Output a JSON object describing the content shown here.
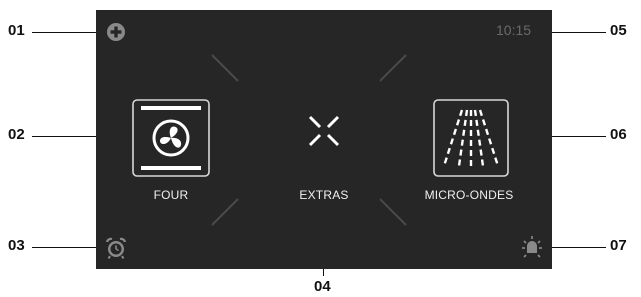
{
  "callouts": {
    "c01": "01",
    "c02": "02",
    "c03": "03",
    "c04": "04",
    "c05": "05",
    "c06": "06",
    "c07": "07"
  },
  "screen": {
    "time": "10:15",
    "modes": {
      "left": "FOUR",
      "center": "EXTRAS",
      "right": "MICRO-ONDES"
    }
  },
  "icons": {
    "top_left": "plus-circle-icon",
    "bottom_left": "alarm-clock-icon",
    "bottom_right": "light-bulb-icon",
    "left_mode": "fan-oven-icon",
    "center_mode": "cross-arrows-icon",
    "right_mode": "microwave-waves-icon"
  },
  "colors": {
    "screen_bg": "#262626",
    "icon_grey": "#8a8a8a",
    "text_white": "#f0f0f0",
    "clock_grey": "#6a6a6a"
  }
}
